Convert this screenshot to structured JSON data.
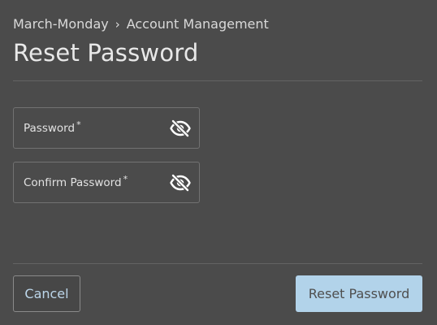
{
  "breadcrumb": {
    "org": "March-Monday",
    "separator": "›",
    "section": "Account Management"
  },
  "title": "Reset Password",
  "fields": [
    {
      "label": "Password",
      "required_mark": "*",
      "icon": "eye-off-icon"
    },
    {
      "label": "Confirm Password",
      "required_mark": "*",
      "icon": "eye-off-icon"
    }
  ],
  "buttons": {
    "cancel": "Cancel",
    "reset": "Reset Password"
  },
  "colors": {
    "background": "#4b4b4b",
    "primary_button": "#b2d3ea",
    "cancel_text": "#bcd6ea"
  }
}
